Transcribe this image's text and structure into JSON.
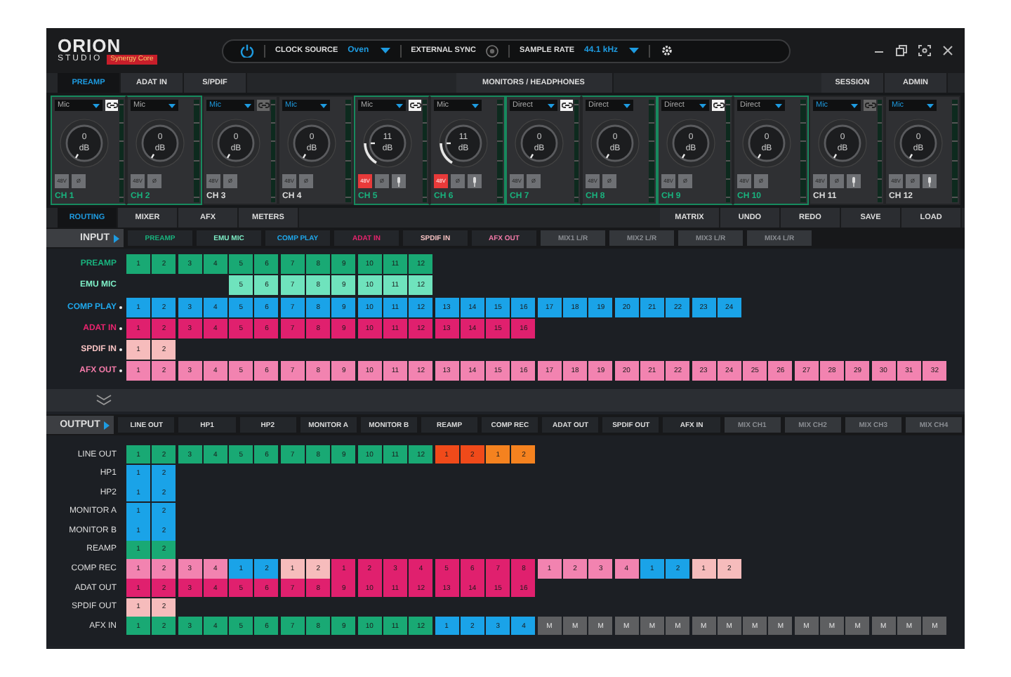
{
  "window": {
    "logo": "ORION",
    "logo_sub": "STUDIO",
    "badge": "Synergy Core"
  },
  "transport": {
    "clock_source_label": "CLOCK SOURCE",
    "clock_source": "Oven",
    "external_sync_label": "EXTERNAL SYNC",
    "external_sync": false,
    "sample_rate_label": "SAMPLE RATE",
    "sample_rate": "44.1 kHz"
  },
  "nav_tabs": [
    {
      "label": "PREAMP",
      "selected": true
    },
    {
      "label": "ADAT IN",
      "selected": false
    },
    {
      "label": "S/PDIF",
      "selected": false
    }
  ],
  "nav_center_tabs": [
    {
      "label": "MONITORS / HEADPHONES",
      "selected": false
    }
  ],
  "nav_right_tabs": [
    {
      "label": "SESSION",
      "selected": false
    },
    {
      "label": "ADMIN",
      "selected": false
    }
  ],
  "channels": [
    {
      "input": "Mic",
      "link": true,
      "linked": true,
      "gain": "0",
      "unit": "dB",
      "level": 0,
      "phantom": {
        "label": "48V",
        "on": false
      },
      "phase": {
        "label": "Ø",
        "on": false
      },
      "label": "CH 1"
    },
    {
      "input": "Mic",
      "linked": true,
      "gain": "0",
      "unit": "dB",
      "level": 0,
      "phantom": {
        "label": "48V",
        "on": false
      },
      "phase": {
        "label": "Ø",
        "on": false
      },
      "label": "CH 2"
    },
    {
      "input": "Mic",
      "link": false,
      "linked": false,
      "gain": "0",
      "unit": "dB",
      "level": 0,
      "phantom": {
        "label": "48V",
        "on": false
      },
      "phase": {
        "label": "Ø",
        "on": false
      },
      "label": "CH 3"
    },
    {
      "input": "Mic",
      "linked": false,
      "gain": "0",
      "unit": "dB",
      "level": 0,
      "phantom": {
        "label": "48V",
        "on": false
      },
      "phase": {
        "label": "Ø",
        "on": false
      },
      "label": "CH 4"
    },
    {
      "input": "Mic",
      "link": true,
      "linked": true,
      "gain": "11",
      "unit": "dB",
      "level": 0.2,
      "phantom": {
        "label": "48V",
        "on": true
      },
      "phase": {
        "label": "Ø",
        "on": false
      },
      "hiz": {
        "on": false
      },
      "label": "CH 5"
    },
    {
      "input": "Mic",
      "linked": true,
      "gain": "11",
      "unit": "dB",
      "level": 0.2,
      "phantom": {
        "label": "48V",
        "on": true
      },
      "phase": {
        "label": "Ø",
        "on": false
      },
      "hiz": {
        "on": false
      },
      "label": "CH 6"
    },
    {
      "input": "Direct",
      "link": true,
      "linked": true,
      "gain": "0",
      "unit": "dB",
      "level": 0,
      "phantom": {
        "label": "48V",
        "on": false
      },
      "phase": {
        "label": "Ø",
        "on": false
      },
      "label": "CH 7"
    },
    {
      "input": "Direct",
      "linked": true,
      "gain": "0",
      "unit": "dB",
      "level": 0,
      "phantom": {
        "label": "48V",
        "on": false
      },
      "phase": {
        "label": "Ø",
        "on": false
      },
      "label": "CH 8"
    },
    {
      "input": "Direct",
      "link": true,
      "linked": true,
      "gain": "0",
      "unit": "dB",
      "level": 0,
      "phantom": {
        "label": "48V",
        "on": false
      },
      "phase": {
        "label": "Ø",
        "on": false
      },
      "label": "CH 9"
    },
    {
      "input": "Direct",
      "linked": true,
      "gain": "0",
      "unit": "dB",
      "level": 0,
      "phantom": {
        "label": "48V",
        "on": false
      },
      "phase": {
        "label": "Ø",
        "on": false
      },
      "label": "CH 10"
    },
    {
      "input": "Mic",
      "link": false,
      "linked": false,
      "gain": "0",
      "unit": "dB",
      "level": 0,
      "phantom": {
        "label": "48V",
        "on": false
      },
      "phase": {
        "label": "Ø",
        "on": false
      },
      "hiz": {
        "on": false
      },
      "label": "CH 11"
    },
    {
      "input": "Mic",
      "linked": false,
      "gain": "0",
      "unit": "dB",
      "level": 0,
      "phantom": {
        "label": "48V",
        "on": false
      },
      "phase": {
        "label": "Ø",
        "on": false
      },
      "hiz": {
        "on": false
      },
      "label": "CH 12"
    }
  ],
  "routing_tabs": [
    {
      "label": "ROUTING",
      "selected": true
    },
    {
      "label": "MIXER",
      "selected": false
    },
    {
      "label": "AFX",
      "selected": false
    },
    {
      "label": "METERS",
      "selected": false
    }
  ],
  "actions": [
    "MATRIX",
    "UNDO",
    "REDO",
    "SAVE",
    "LOAD"
  ],
  "input": {
    "title": "INPUT",
    "tabs": [
      {
        "label": "PREAMP",
        "color": "#19b37e",
        "disabled": false
      },
      {
        "label": "EMU MIC",
        "color": "#7ff0c8",
        "disabled": false
      },
      {
        "label": "COMP PLAY",
        "color": "#1fa8ec",
        "disabled": false
      },
      {
        "label": "ADAT IN",
        "color": "#e8246e",
        "disabled": false
      },
      {
        "label": "SPDIF IN",
        "color": "#f6c2c2",
        "disabled": false
      },
      {
        "label": "AFX OUT",
        "color": "#f27aa8",
        "disabled": false
      },
      {
        "label": "MIX1 L/R",
        "disabled": true
      },
      {
        "label": "MIX2 L/R",
        "disabled": true
      },
      {
        "label": "MIX3 L/R",
        "disabled": true
      },
      {
        "label": "MIX4 L/R",
        "disabled": true
      }
    ],
    "rows": [
      {
        "label": "PREAMP",
        "color": "#19b37e",
        "dot": false,
        "segments": [
          {
            "color": "#19a974",
            "cells": [
              "1",
              "2",
              "3",
              "4",
              "5",
              "6",
              "7",
              "8",
              "9",
              "10",
              "11",
              "12"
            ]
          }
        ]
      },
      {
        "label": "EMU MIC",
        "color": "#7ff0c8",
        "dot": false,
        "segments": [
          {
            "color": "#6fe3bd",
            "cells": [
              null,
              null,
              null,
              null,
              "5",
              "6",
              "7",
              "8",
              "9",
              "10",
              "11",
              "12"
            ]
          }
        ]
      },
      {
        "label": "COMP PLAY",
        "color": "#1fa8ec",
        "dot": true,
        "segments": [
          {
            "color": "#1aa3e8",
            "cells": [
              "1",
              "2",
              "3",
              "4",
              "5",
              "6",
              "7",
              "8",
              "9",
              "10",
              "11",
              "12",
              "13",
              "14",
              "15",
              "16",
              "17",
              "18",
              "19",
              "20",
              "21",
              "22",
              "23",
              "24"
            ]
          }
        ]
      },
      {
        "label": "ADAT IN",
        "color": "#e8246e",
        "dot": true,
        "segments": [
          {
            "color": "#e0206e",
            "cells": [
              "1",
              "2",
              "3",
              "4",
              "5",
              "6",
              "7",
              "8",
              "9",
              "10",
              "11",
              "12",
              "13",
              "14",
              "15",
              "16"
            ]
          }
        ]
      },
      {
        "label": "SPDIF IN",
        "color": "#f6c2c2",
        "dot": true,
        "segments": [
          {
            "color": "#f6bcbc",
            "cells": [
              "1",
              "2"
            ]
          }
        ]
      },
      {
        "label": "AFX OUT",
        "color": "#f27aa8",
        "dot": true,
        "segments": [
          {
            "color": "#f283b0",
            "cells": [
              "1",
              "2",
              "3",
              "4",
              "5",
              "6",
              "7",
              "8",
              "9",
              "10",
              "11",
              "12",
              "13",
              "14",
              "15",
              "16",
              "17",
              "18",
              "19",
              "20",
              "21",
              "22",
              "23",
              "24",
              "25",
              "26",
              "27",
              "28",
              "29",
              "30",
              "31",
              "32"
            ]
          }
        ]
      }
    ]
  },
  "output": {
    "title": "OUTPUT",
    "tabs": [
      {
        "label": "LINE OUT",
        "disabled": false
      },
      {
        "label": "HP1",
        "disabled": false
      },
      {
        "label": "HP2",
        "disabled": false
      },
      {
        "label": "MONITOR A",
        "disabled": false
      },
      {
        "label": "MONITOR B",
        "disabled": false
      },
      {
        "label": "REAMP",
        "disabled": false
      },
      {
        "label": "COMP REC",
        "disabled": false
      },
      {
        "label": "ADAT OUT",
        "disabled": false
      },
      {
        "label": "SPDIF OUT",
        "disabled": false
      },
      {
        "label": "AFX IN",
        "disabled": false
      },
      {
        "label": "MIX CH1",
        "disabled": true
      },
      {
        "label": "MIX CH2",
        "disabled": true
      },
      {
        "label": "MIX CH3",
        "disabled": true
      },
      {
        "label": "MIX CH4",
        "disabled": true
      }
    ],
    "rows": [
      {
        "label": "LINE OUT",
        "segments": [
          {
            "color": "#19a974",
            "cells": [
              "1",
              "2",
              "3",
              "4",
              "5",
              "6",
              "7",
              "8",
              "9",
              "10",
              "11",
              "12"
            ]
          },
          {
            "color": "#f04a1a",
            "cells": [
              "1",
              "2"
            ]
          },
          {
            "color": "#f5821f",
            "cells": [
              "1",
              "2"
            ]
          }
        ]
      },
      {
        "label": "HP1",
        "segments": [
          {
            "color": "#1aa3e8",
            "cells": [
              "1",
              "2"
            ]
          }
        ]
      },
      {
        "label": "HP2",
        "segments": [
          {
            "color": "#1aa3e8",
            "cells": [
              "1",
              "2"
            ]
          }
        ]
      },
      {
        "label": "MONITOR A",
        "segments": [
          {
            "color": "#1aa3e8",
            "cells": [
              "1",
              "2"
            ]
          }
        ]
      },
      {
        "label": "MONITOR B",
        "segments": [
          {
            "color": "#1aa3e8",
            "cells": [
              "1",
              "2"
            ]
          }
        ]
      },
      {
        "label": "REAMP",
        "segments": [
          {
            "color": "#19a974",
            "cells": [
              "1",
              "2"
            ]
          }
        ]
      },
      {
        "label": "COMP REC",
        "segments": [
          {
            "color": "#f283b0",
            "cells": [
              "1",
              "2",
              "3",
              "4"
            ]
          },
          {
            "color": "#1aa3e8",
            "cells": [
              "1",
              "2"
            ]
          },
          {
            "color": "#f6bcbc",
            "cells": [
              "1",
              "2"
            ]
          },
          {
            "color": "#e0206e",
            "cells": [
              "1",
              "2",
              "3",
              "4",
              "5",
              "6",
              "7",
              "8"
            ]
          },
          {
            "color": "#f283b0",
            "cells": [
              "1",
              "2",
              "3",
              "4"
            ]
          },
          {
            "color": "#1aa3e8",
            "cells": [
              "1",
              "2"
            ]
          },
          {
            "color": "#f6bcbc",
            "cells": [
              "1",
              "2"
            ]
          }
        ]
      },
      {
        "label": "ADAT OUT",
        "segments": [
          {
            "color": "#e0206e",
            "cells": [
              "1",
              "2",
              "3",
              "4",
              "5",
              "6",
              "7",
              "8",
              "9",
              "10",
              "11",
              "12",
              "13",
              "14",
              "15",
              "16"
            ]
          }
        ]
      },
      {
        "label": "SPDIF OUT",
        "segments": [
          {
            "color": "#f6bcbc",
            "cells": [
              "1",
              "2"
            ]
          }
        ]
      },
      {
        "label": "AFX IN",
        "segments": [
          {
            "color": "#19a974",
            "cells": [
              "1",
              "2",
              "3",
              "4",
              "5",
              "6",
              "7",
              "8",
              "9",
              "10",
              "11",
              "12"
            ]
          },
          {
            "color": "#1aa3e8",
            "cells": [
              "1",
              "2",
              "3",
              "4"
            ]
          },
          {
            "color": "#5e5f61",
            "cells": [
              "M",
              "M",
              "M",
              "M",
              "M",
              "M",
              "M",
              "M",
              "M",
              "M",
              "M",
              "M",
              "M",
              "M",
              "M",
              "M"
            ]
          }
        ]
      }
    ]
  }
}
